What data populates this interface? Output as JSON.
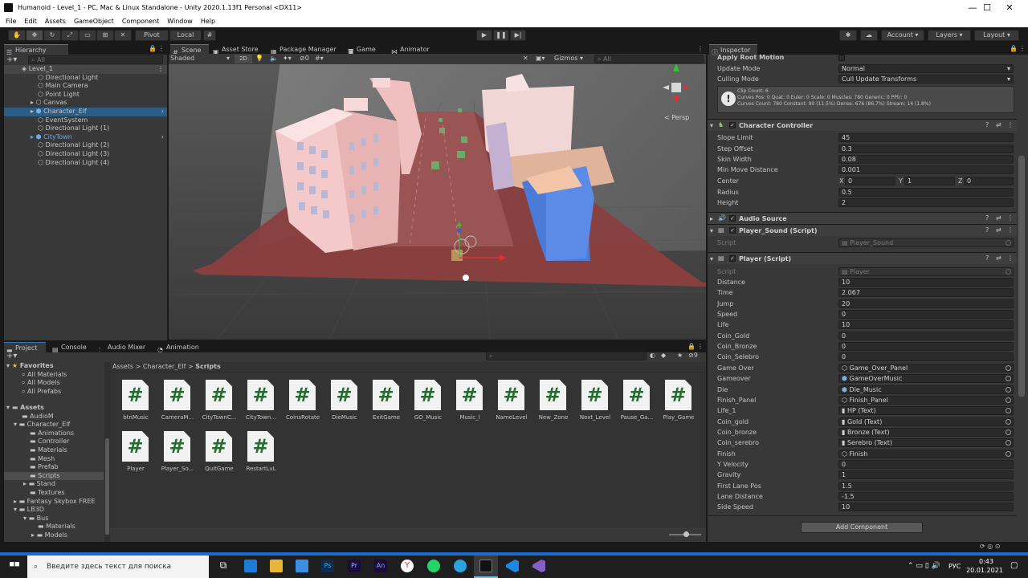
{
  "window": {
    "title": "Humanoid - Level_1 - PC, Mac & Linux Standalone - Unity 2020.1.13f1 Personal <DX11>",
    "minimize": "—",
    "maximize": "☐",
    "close": "✕"
  },
  "menu": [
    "File",
    "Edit",
    "Assets",
    "GameObject",
    "Component",
    "Window",
    "Help"
  ],
  "toolbar": {
    "pivot": "Pivot",
    "local": "Local",
    "account": "Account",
    "layers": "Layers",
    "layout": "Layout"
  },
  "hierarchy": {
    "tab": "Hierarchy",
    "search_placeholder": "All",
    "scene": "Level_1",
    "items": [
      "Directional Light",
      "Main Camera",
      "Point Light",
      "Canvas",
      "Character_Elf",
      "EventSystem",
      "Directional Light (1)",
      "CityTown",
      "Directional Light (2)",
      "Directional Light (3)",
      "Directional Light (4)"
    ]
  },
  "scene_tabs": [
    "Scene",
    "Asset Store",
    "Package Manager",
    "Game",
    "Animator"
  ],
  "scene_toolbar": {
    "shading": "Shaded",
    "mode2d": "2D",
    "hidden_count": "0",
    "gizmos": "Gizmos",
    "search_placeholder": "All",
    "persp": "< Persp"
  },
  "bottom_tabs": [
    "Project",
    "Console",
    "Audio Mixer",
    "Animation"
  ],
  "project": {
    "favorites_label": "Favorites",
    "favorites": [
      "All Materials",
      "All Models",
      "All Prefabs"
    ],
    "assets_label": "Assets",
    "tree": [
      "AudioM",
      "Character_Elf",
      "Animations",
      "Controller",
      "Materials",
      "Mesh",
      "Prefab",
      "Scripts",
      "Stand",
      "Textures",
      "Fantasy Skybox FREE",
      "LB3D",
      "Bus",
      "Materials",
      "Models"
    ],
    "breadcrumb": [
      "Assets",
      "Character_Elf",
      "Scripts"
    ],
    "badge_count": "9",
    "scripts": [
      "btnMusic",
      "CameraM...",
      "CityTownC...",
      "CityTown...",
      "CoinsRotate",
      "DieMusic",
      "ExitGame",
      "GO_Music",
      "Music_l",
      "NameLevel",
      "New_Zone",
      "Next_Level",
      "Pause_Ga...",
      "Play_Game",
      "Player",
      "Player_So...",
      "QuitGame",
      "RestartLvL"
    ]
  },
  "inspector": {
    "tab": "Inspector",
    "animator": {
      "apply_root_motion": "Apply Root Motion",
      "update_mode_label": "Update Mode",
      "update_mode": "Normal",
      "culling_label": "Culling Mode",
      "culling": "Cull Update Transforms",
      "info1": "Clip Count: 6",
      "info2": "Curves Pos: 0 Quat: 0 Euler: 0 Scale: 0 Muscles: 780 Generic: 0 PPtr: 0",
      "info3": "Curves Count: 780 Constant: 90 (11.5%) Dense: 676 (86.7%) Stream: 14 (1.8%)"
    },
    "character_controller": {
      "name": "Character Controller",
      "fields": [
        {
          "label": "Slope Limit",
          "value": "45"
        },
        {
          "label": "Step Offset",
          "value": "0.3"
        },
        {
          "label": "Skin Width",
          "value": "0.08"
        },
        {
          "label": "Min Move Distance",
          "value": "0.001"
        }
      ],
      "center_label": "Center",
      "cx": "0",
      "cy": "1",
      "cz": "0",
      "radius_label": "Radius",
      "radius": "0.5",
      "height_label": "Height",
      "height": "2"
    },
    "audio_source": "Audio Source",
    "player_sound": {
      "name": "Player_Sound (Script)",
      "script_label": "Script",
      "script": "Player_Sound"
    },
    "player": {
      "name": "Player (Script)",
      "script_label": "Script",
      "script": "Player",
      "fields": [
        {
          "label": "Distance",
          "value": "10"
        },
        {
          "label": "Time",
          "value": "2.067"
        },
        {
          "label": "Jump",
          "value": "20"
        },
        {
          "label": "Speed",
          "value": "0"
        },
        {
          "label": "Life",
          "value": "10"
        },
        {
          "label": "Coin_Gold",
          "value": "0"
        },
        {
          "label": "Coin_Bronze",
          "value": "0"
        },
        {
          "label": "Coin_Selebro",
          "value": "0"
        }
      ],
      "refs": [
        {
          "label": "Game Over",
          "value": "Game_Over_Panel"
        },
        {
          "label": "Gameover",
          "value": "GameOverMusic"
        },
        {
          "label": "Die",
          "value": "Die_Music"
        },
        {
          "label": "Finish_Panel",
          "value": "Finish_Panel"
        },
        {
          "label": "Life_1",
          "value": "HP (Text)"
        },
        {
          "label": "Coin_gold",
          "value": "Gold (Text)"
        },
        {
          "label": "Coin_bronze",
          "value": "Bronze (Text)"
        },
        {
          "label": "Coin_serebro",
          "value": "Serebro (Text)"
        },
        {
          "label": "Finish",
          "value": "Finish"
        }
      ],
      "tail": [
        {
          "label": "Y Velocity",
          "value": "0"
        },
        {
          "label": "Gravity",
          "value": "1"
        },
        {
          "label": "First Lane Pos",
          "value": "1.5"
        },
        {
          "label": "Lane Distance",
          "value": "-1.5"
        },
        {
          "label": "Side Speed",
          "value": "10"
        }
      ]
    },
    "add_component": "Add Component"
  },
  "taskbar": {
    "search_placeholder": "Введите здесь текст для поиска",
    "lang": "РУС",
    "time": "0:43",
    "date": "20.01.2021"
  }
}
